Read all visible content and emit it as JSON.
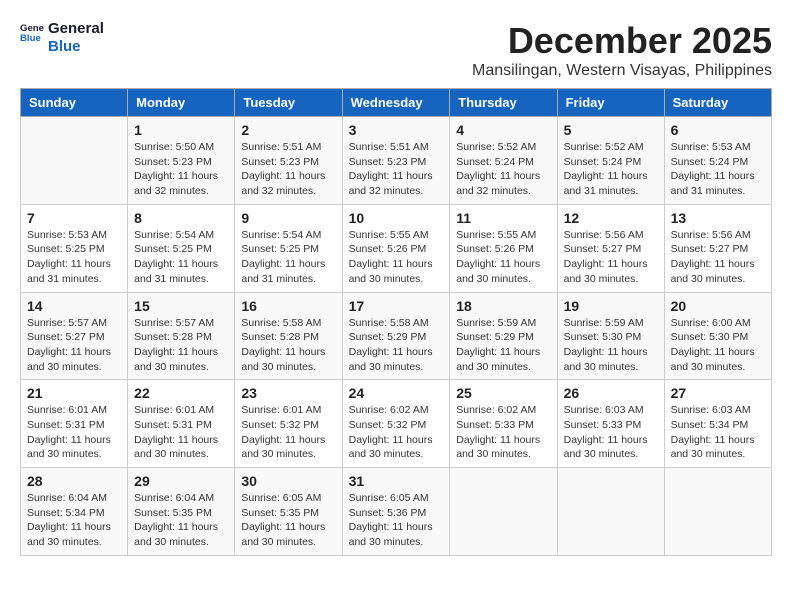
{
  "logo": {
    "line1": "General",
    "line2": "Blue"
  },
  "title": "December 2025",
  "location": "Mansilingan, Western Visayas, Philippines",
  "weekdays": [
    "Sunday",
    "Monday",
    "Tuesday",
    "Wednesday",
    "Thursday",
    "Friday",
    "Saturday"
  ],
  "weeks": [
    [
      {
        "day": "",
        "info": ""
      },
      {
        "day": "1",
        "info": "Sunrise: 5:50 AM\nSunset: 5:23 PM\nDaylight: 11 hours\nand 32 minutes."
      },
      {
        "day": "2",
        "info": "Sunrise: 5:51 AM\nSunset: 5:23 PM\nDaylight: 11 hours\nand 32 minutes."
      },
      {
        "day": "3",
        "info": "Sunrise: 5:51 AM\nSunset: 5:23 PM\nDaylight: 11 hours\nand 32 minutes."
      },
      {
        "day": "4",
        "info": "Sunrise: 5:52 AM\nSunset: 5:24 PM\nDaylight: 11 hours\nand 32 minutes."
      },
      {
        "day": "5",
        "info": "Sunrise: 5:52 AM\nSunset: 5:24 PM\nDaylight: 11 hours\nand 31 minutes."
      },
      {
        "day": "6",
        "info": "Sunrise: 5:53 AM\nSunset: 5:24 PM\nDaylight: 11 hours\nand 31 minutes."
      }
    ],
    [
      {
        "day": "7",
        "info": "Sunrise: 5:53 AM\nSunset: 5:25 PM\nDaylight: 11 hours\nand 31 minutes."
      },
      {
        "day": "8",
        "info": "Sunrise: 5:54 AM\nSunset: 5:25 PM\nDaylight: 11 hours\nand 31 minutes."
      },
      {
        "day": "9",
        "info": "Sunrise: 5:54 AM\nSunset: 5:25 PM\nDaylight: 11 hours\nand 31 minutes."
      },
      {
        "day": "10",
        "info": "Sunrise: 5:55 AM\nSunset: 5:26 PM\nDaylight: 11 hours\nand 30 minutes."
      },
      {
        "day": "11",
        "info": "Sunrise: 5:55 AM\nSunset: 5:26 PM\nDaylight: 11 hours\nand 30 minutes."
      },
      {
        "day": "12",
        "info": "Sunrise: 5:56 AM\nSunset: 5:27 PM\nDaylight: 11 hours\nand 30 minutes."
      },
      {
        "day": "13",
        "info": "Sunrise: 5:56 AM\nSunset: 5:27 PM\nDaylight: 11 hours\nand 30 minutes."
      }
    ],
    [
      {
        "day": "14",
        "info": "Sunrise: 5:57 AM\nSunset: 5:27 PM\nDaylight: 11 hours\nand 30 minutes."
      },
      {
        "day": "15",
        "info": "Sunrise: 5:57 AM\nSunset: 5:28 PM\nDaylight: 11 hours\nand 30 minutes."
      },
      {
        "day": "16",
        "info": "Sunrise: 5:58 AM\nSunset: 5:28 PM\nDaylight: 11 hours\nand 30 minutes."
      },
      {
        "day": "17",
        "info": "Sunrise: 5:58 AM\nSunset: 5:29 PM\nDaylight: 11 hours\nand 30 minutes."
      },
      {
        "day": "18",
        "info": "Sunrise: 5:59 AM\nSunset: 5:29 PM\nDaylight: 11 hours\nand 30 minutes."
      },
      {
        "day": "19",
        "info": "Sunrise: 5:59 AM\nSunset: 5:30 PM\nDaylight: 11 hours\nand 30 minutes."
      },
      {
        "day": "20",
        "info": "Sunrise: 6:00 AM\nSunset: 5:30 PM\nDaylight: 11 hours\nand 30 minutes."
      }
    ],
    [
      {
        "day": "21",
        "info": "Sunrise: 6:01 AM\nSunset: 5:31 PM\nDaylight: 11 hours\nand 30 minutes."
      },
      {
        "day": "22",
        "info": "Sunrise: 6:01 AM\nSunset: 5:31 PM\nDaylight: 11 hours\nand 30 minutes."
      },
      {
        "day": "23",
        "info": "Sunrise: 6:01 AM\nSunset: 5:32 PM\nDaylight: 11 hours\nand 30 minutes."
      },
      {
        "day": "24",
        "info": "Sunrise: 6:02 AM\nSunset: 5:32 PM\nDaylight: 11 hours\nand 30 minutes."
      },
      {
        "day": "25",
        "info": "Sunrise: 6:02 AM\nSunset: 5:33 PM\nDaylight: 11 hours\nand 30 minutes."
      },
      {
        "day": "26",
        "info": "Sunrise: 6:03 AM\nSunset: 5:33 PM\nDaylight: 11 hours\nand 30 minutes."
      },
      {
        "day": "27",
        "info": "Sunrise: 6:03 AM\nSunset: 5:34 PM\nDaylight: 11 hours\nand 30 minutes."
      }
    ],
    [
      {
        "day": "28",
        "info": "Sunrise: 6:04 AM\nSunset: 5:34 PM\nDaylight: 11 hours\nand 30 minutes."
      },
      {
        "day": "29",
        "info": "Sunrise: 6:04 AM\nSunset: 5:35 PM\nDaylight: 11 hours\nand 30 minutes."
      },
      {
        "day": "30",
        "info": "Sunrise: 6:05 AM\nSunset: 5:35 PM\nDaylight: 11 hours\nand 30 minutes."
      },
      {
        "day": "31",
        "info": "Sunrise: 6:05 AM\nSunset: 5:36 PM\nDaylight: 11 hours\nand 30 minutes."
      },
      {
        "day": "",
        "info": ""
      },
      {
        "day": "",
        "info": ""
      },
      {
        "day": "",
        "info": ""
      }
    ]
  ]
}
